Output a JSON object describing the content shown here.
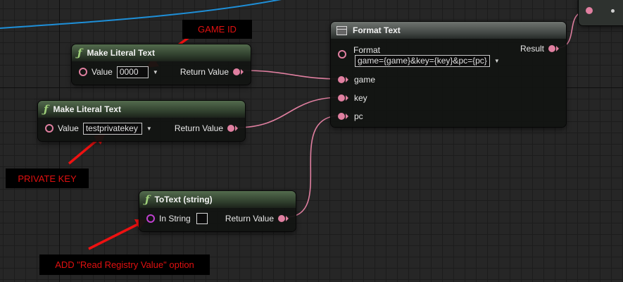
{
  "annotations": {
    "game_id": "GAME ID",
    "private_key": "PRIVATE KEY",
    "add_option": "ADD \"Read Registry Value\" option"
  },
  "node1": {
    "title": "Make Literal Text",
    "value_label": "Value",
    "value": "0000",
    "return_label": "Return Value"
  },
  "node2": {
    "title": "Make Literal Text",
    "value_label": "Value",
    "value": "testprivatekey",
    "return_label": "Return Value"
  },
  "node3": {
    "title": "ToText (string)",
    "in_label": "In String",
    "return_label": "Return Value"
  },
  "format_node": {
    "title": "Format Text",
    "format_label": "Format",
    "format_value": "game={game}&key={key}&pc={pc}",
    "result_label": "Result",
    "pins": [
      "game",
      "key",
      "pc"
    ]
  },
  "colors": {
    "text_pin": "#e07fa0",
    "string_pin": "#c040d0",
    "exec_wire": "#1e8fd8",
    "annotation_text": "#e01010",
    "annotation_arrow": "#ee1111"
  },
  "icons": {
    "function": "function-icon",
    "format_text": "table-icon",
    "dropdown": "chevron-down-icon",
    "checkbox": "checkbox-icon"
  }
}
